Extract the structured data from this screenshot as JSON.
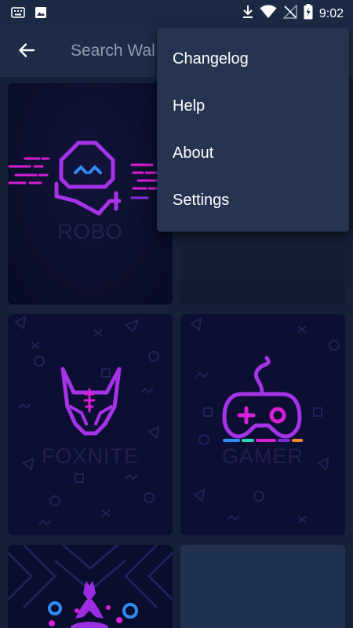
{
  "status_bar": {
    "time": "9:02",
    "left_icons": [
      "keyboard-icon",
      "image-icon"
    ],
    "right_icons": [
      "download-icon",
      "wifi-icon",
      "no-signal-icon",
      "battery-charging-icon"
    ]
  },
  "app_bar": {
    "back_icon": "arrow-left-icon",
    "search_placeholder": "Search Wal"
  },
  "overflow_menu": {
    "items": [
      "Changelog",
      "Help",
      "About",
      "Settings"
    ]
  },
  "wallpapers": [
    {
      "title": "ROBO"
    },
    {
      "title": ""
    },
    {
      "title": "FOXNITE"
    },
    {
      "title": "GAMER"
    },
    {
      "title": ""
    },
    {
      "title": ""
    }
  ],
  "colors": {
    "status_bar": "#1b2a44",
    "app_bar": "#1d2c47",
    "grid_background": "#152039",
    "menu_background": "#253551",
    "neon_purple": "#a633e8",
    "neon_magenta": "#d61fd6",
    "neon_blue": "#2f8df5"
  }
}
